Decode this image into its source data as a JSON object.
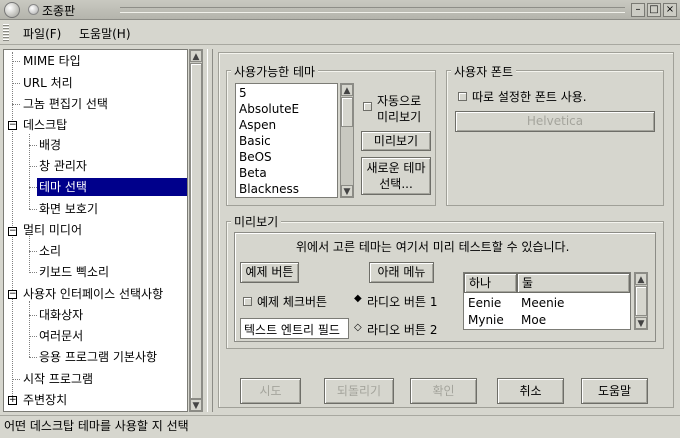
{
  "window": {
    "title": "조종판"
  },
  "menu": {
    "file": "파일(F)",
    "help": "도움말(H)"
  },
  "tree": {
    "items": [
      {
        "label": "MIME 타입"
      },
      {
        "label": "URL 처리"
      },
      {
        "label": "그놈 편집기 선택"
      },
      {
        "label": "데스크탑"
      },
      {
        "label": "배경"
      },
      {
        "label": "창 관리자"
      },
      {
        "label": "테마 선택"
      },
      {
        "label": "화면 보호기"
      },
      {
        "label": "멀티 미디어"
      },
      {
        "label": "소리"
      },
      {
        "label": "키보드 삑소리"
      },
      {
        "label": "사용자 인터페이스 선택사항"
      },
      {
        "label": "대화상자"
      },
      {
        "label": "여러문서"
      },
      {
        "label": "응용 프로그램 기본사항"
      },
      {
        "label": "시작 프로그램"
      },
      {
        "label": "주변장치"
      }
    ]
  },
  "themes": {
    "label": "사용가능한 테마",
    "items": [
      "5",
      "AbsoluteE",
      "Aspen",
      "Basic",
      "BeOS",
      "Beta",
      "Blackness"
    ],
    "auto_preview_line1": "자동으로",
    "auto_preview_line2": "미리보기",
    "preview_button": "미리보기",
    "install_line1": "새로운 테마",
    "install_line2": "선택..."
  },
  "font": {
    "label": "사용자 폰트",
    "custom_checkbox": "따로 설정한 폰트 사용.",
    "font_button": "Helvetica"
  },
  "preview": {
    "label": "미리보기",
    "description": "위에서 고른 테마는 여기서 미리 테스트할 수 있습니다.",
    "example_button": "예제 버튼",
    "arrow_menu": "아래 메뉴",
    "example_check": "예제 체크버튼",
    "radio1": "라디오 버튼 1",
    "radio2": "라디오 버튼 2",
    "entry_value": "텍스트 엔트리 필드",
    "columns": [
      "하나",
      "둘"
    ],
    "rows": [
      [
        "Eenie",
        "Meenie"
      ],
      [
        "Mynie",
        "Moe"
      ]
    ]
  },
  "buttons": {
    "try": "시도",
    "revert": "되돌리기",
    "ok": "확인",
    "cancel": "취소",
    "help": "도움말"
  },
  "status": "어떤 데스크탑 테마를 사용할 지 선택"
}
